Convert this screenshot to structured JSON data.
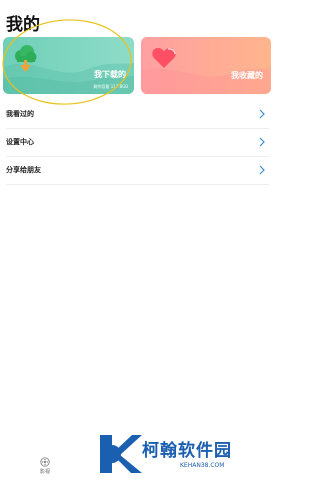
{
  "header": {
    "title": "我的"
  },
  "cards": {
    "downloads": {
      "label": "我下载的",
      "storage": "剩余容量 117.8GB"
    },
    "favorites": {
      "label": "我收藏的"
    }
  },
  "menu": {
    "items": [
      {
        "label": "我看过的"
      },
      {
        "label": "设置中心"
      },
      {
        "label": "分享给朋友"
      }
    ]
  },
  "bottom_nav": {
    "tab_label": "影视"
  },
  "watermark": {
    "name": "柯翰软件园",
    "domain": "KEHAN38.COM"
  },
  "colors": {
    "downloads_card": "#7fd6c0",
    "favorites_card": "#ffa99a",
    "annotation": "#e8c21a",
    "chevron": "#3a8fd6",
    "watermark": "#1b5fb0"
  }
}
